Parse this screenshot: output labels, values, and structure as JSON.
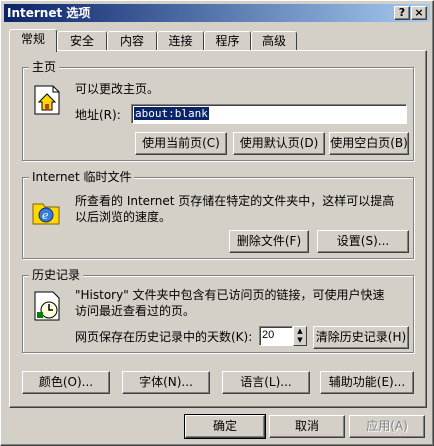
{
  "window": {
    "title": "Internet 选项",
    "help_label": "?",
    "close_label": "×"
  },
  "tabs": [
    "常规",
    "安全",
    "内容",
    "连接",
    "程序",
    "高级"
  ],
  "homepage": {
    "title": "主页",
    "desc": "可以更改主页。",
    "address_label": "地址(R):",
    "address_value": "about:blank",
    "btn_current": "使用当前页(C)",
    "btn_default": "使用默认页(D)",
    "btn_blank": "使用空白页(B)"
  },
  "temp_files": {
    "title": "Internet 临时文件",
    "desc_line1": "所查看的 Internet 页存储在特定的文件夹中，这样可以提高",
    "desc_line2": "以后浏览的速度。",
    "btn_delete": "删除文件(F)",
    "btn_settings": "设置(S)..."
  },
  "history": {
    "title": "历史记录",
    "desc_line1": "\"History\" 文件夹中包含有已访问页的链接，可使用户快速",
    "desc_line2": "访问最近查看过的页。",
    "days_label": "网页保存在历史记录中的天数(K):",
    "days_value": "20",
    "btn_clear": "清除历史记录(H)"
  },
  "bottom_buttons": {
    "colors": "颜色(O)...",
    "fonts": "字体(N)...",
    "languages": "语言(L)...",
    "accessibility": "辅助功能(E)..."
  },
  "dialog_buttons": {
    "ok": "确定",
    "cancel": "取消",
    "apply": "应用(A)"
  }
}
